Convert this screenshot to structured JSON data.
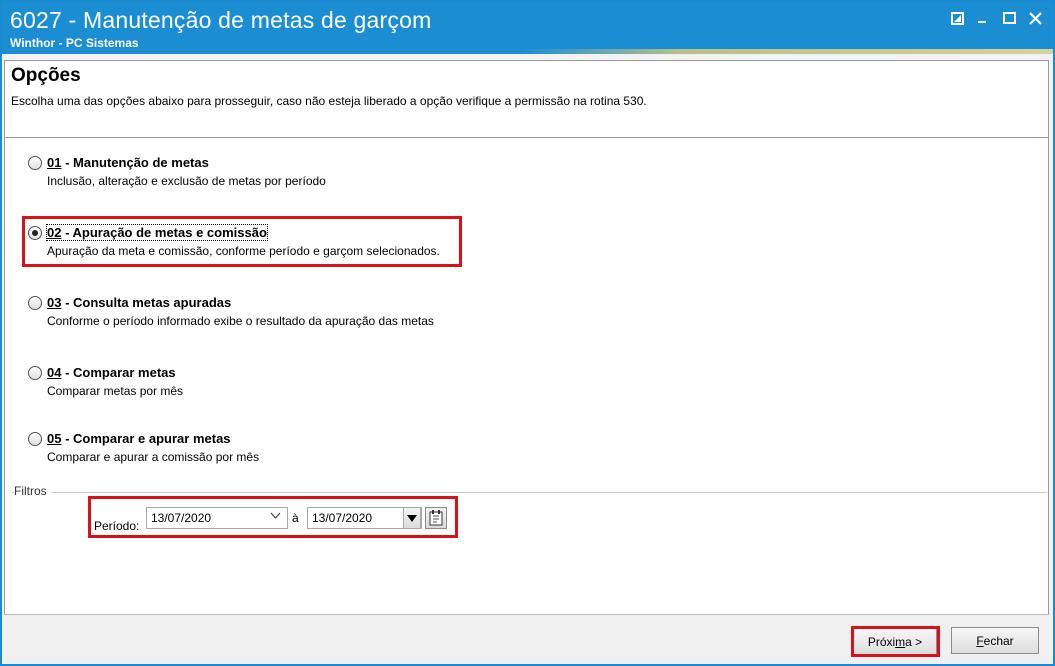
{
  "window": {
    "title": "6027 - Manutenção de metas de garçom",
    "subtitle": "Winthor - PC Sistemas",
    "accent_color": "#1b8ed3",
    "highlight_color": "#d9121a"
  },
  "header": {
    "title": "Opções",
    "description": "Escolha uma das opções abaixo para prosseguir, caso não esteja liberado a opção verifique a permissão na rotina 530."
  },
  "options": [
    {
      "code": "01",
      "title": " - Manutenção de metas",
      "description": "Inclusão, alteração e exclusão de metas por período",
      "selected": false
    },
    {
      "code": "02",
      "title": " - Apuração de metas e comissão",
      "description": "Apuração da meta e comissão, conforme período e garçom selecionados.",
      "selected": true
    },
    {
      "code": "03",
      "title": " - Consulta metas apuradas",
      "description": "Conforme o período informado exibe o resultado da apuração das metas",
      "selected": false
    },
    {
      "code": "04",
      "title": " - Comparar metas",
      "description": "Comparar metas por mês",
      "selected": false
    },
    {
      "code": "05",
      "title": " - Comparar e apurar metas",
      "description": "Comparar e apurar a comissão por mês",
      "selected": false
    }
  ],
  "filters": {
    "group_label": "Filtros",
    "periodo_label": "Período:",
    "date_from": "13/07/2020",
    "separator": "à",
    "date_to": "13/07/2020"
  },
  "footer": {
    "next_label_pre": "Próxi",
    "next_label_ul": "m",
    "next_label_post": "a >",
    "close_label_ul": "F",
    "close_label_post": "echar"
  }
}
